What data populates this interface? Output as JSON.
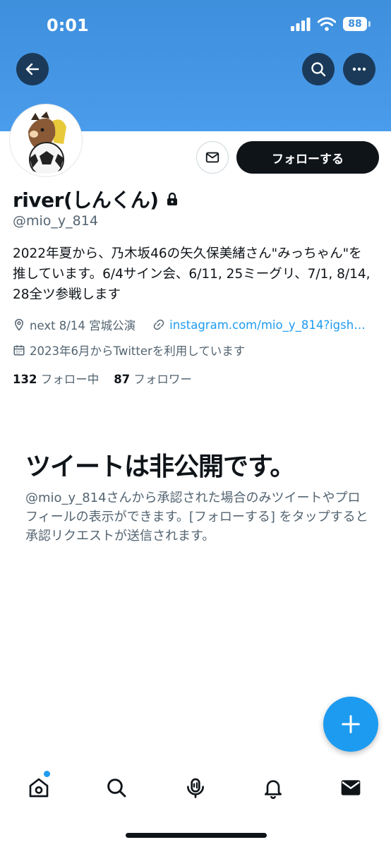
{
  "status_bar": {
    "time": "0:01",
    "battery": "88"
  },
  "header": {
    "banner_color": "#4a9cec",
    "icons": {
      "back": "arrow-left-icon",
      "search": "search-icon",
      "more": "more-icon"
    }
  },
  "profile": {
    "display_name": "river(しんくん)",
    "handle": "@mio_y_814",
    "bio": "2022年夏から、乃木坂46の矢久保美緒さん\"みっちゃん\"を推しています。6/4サイン会、6/11, 25ミーグリ、7/1, 8/14, 28全ツ参戦します",
    "location": "next 8/14 宮城公演",
    "website": "instagram.com/mio_y_814?igsh…",
    "joined": "2023年6月からTwitterを利用しています",
    "following_count": "132",
    "following_label": "フォロー中",
    "followers_count": "87",
    "followers_label": "フォロワー"
  },
  "actions": {
    "follow_label": "フォローする",
    "message_icon": "mail-icon"
  },
  "protected_notice": {
    "title": "ツイートは非公開です。",
    "description": "@mio_y_814さんから承認された場合のみツイートやプロフィールの表示ができます。[フォローする] をタップすると承認リクエストが送信されます。"
  },
  "colors": {
    "accent": "#1d9bf0",
    "text": "#0f1419",
    "secondary_text": "#536471"
  },
  "tab_bar": [
    "home-icon",
    "search-icon",
    "spaces-icon",
    "notifications-icon",
    "messages-icon"
  ]
}
